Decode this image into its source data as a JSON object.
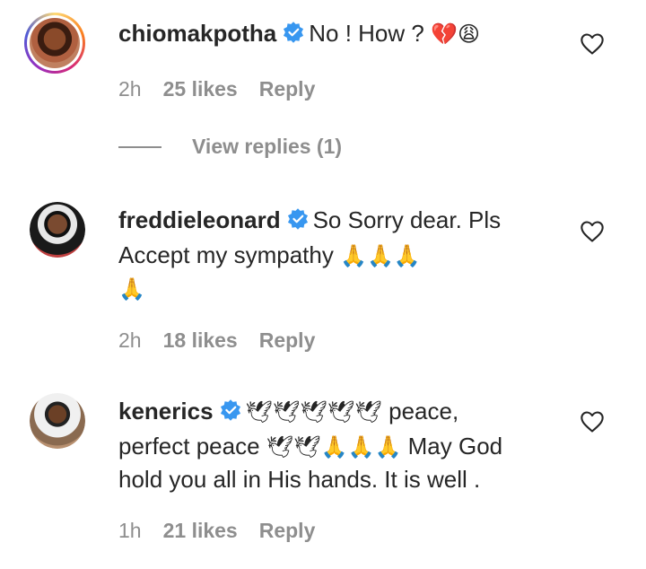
{
  "comments": [
    {
      "username": "chiomakpotha",
      "text": "No ! How ?",
      "emoji": "💔😩",
      "time": "2h",
      "likes": "25 likes",
      "reply": "Reply",
      "view_replies": "View replies (1)"
    },
    {
      "username": "freddieleonard",
      "text_line1": "So Sorry dear. Pls",
      "text_line2": "Accept my sympathy",
      "emoji_line2": "🙏🙏🙏",
      "emoji_line3": "🙏",
      "time": "2h",
      "likes": "18 likes",
      "reply": "Reply"
    },
    {
      "username": "kenerics",
      "emoji1": "🕊🕊🕊🕊🕊",
      "text1": "peace,",
      "text2": "perfect peace",
      "emoji2": "🕊🕊🙏🙏🙏",
      "text3": "May God",
      "text4": "hold you all in His hands. It is well .",
      "time": "1h",
      "likes": "21 likes",
      "reply": "Reply"
    }
  ],
  "colors": {
    "text": "#262626",
    "secondary": "#8e8e8e",
    "verified": "#3897f0"
  },
  "icons": [
    "verified-badge-icon",
    "heart-icon"
  ]
}
